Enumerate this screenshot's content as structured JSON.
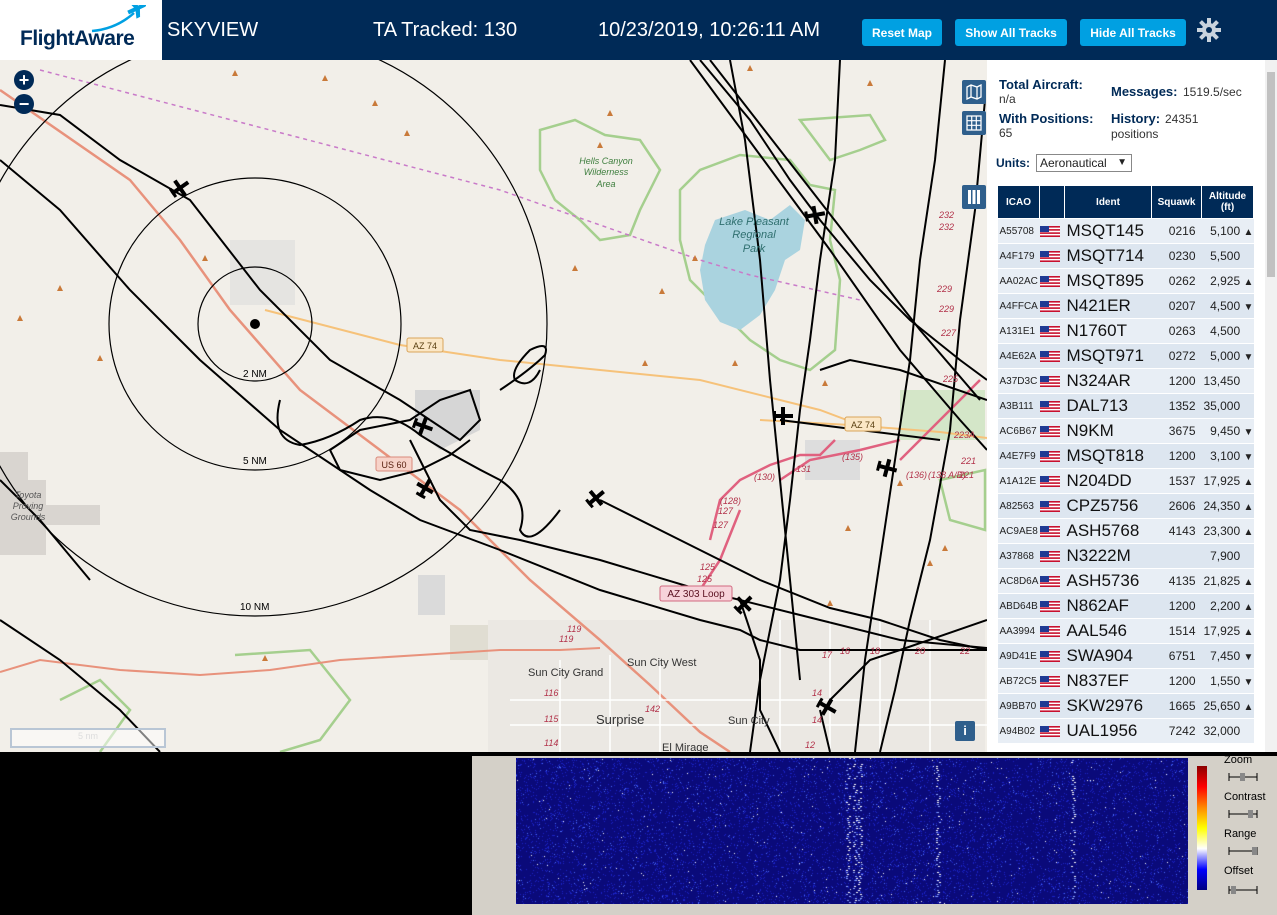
{
  "header": {
    "logo_text": "FlightAware",
    "app_name": "SKYVIEW",
    "tracked": "TA Tracked: 130",
    "datetime": "10/23/2019, 10:26:11 AM",
    "buttons": [
      "Reset Map",
      "Show All Tracks",
      "Hide All Tracks"
    ]
  },
  "map": {
    "zoom_in": "+",
    "zoom_out": "−",
    "scale_label": "5 nm",
    "info": "i",
    "range_labels": [
      "2 NM",
      "5 NM",
      "10 NM"
    ],
    "labels": {
      "hells_canyon": [
        "Hells Canyon",
        "Wilderness",
        "Area"
      ],
      "lake": [
        "Lake Pleasant",
        "Regional",
        "Park"
      ],
      "toyota": [
        "Toyota",
        "Proving",
        "Grounds"
      ],
      "az74_a": "AZ 74",
      "az74_b": "AZ 74",
      "us60": "US 60",
      "az303": "AZ 303 Loop",
      "sun_city_grand": "Sun City Grand",
      "sun_city_west": "Sun City West",
      "surprise": "Surprise",
      "sun_city": "Sun City",
      "el_mirage": "El Mirage",
      "numbers": [
        "232",
        "232",
        "229",
        "229",
        "227",
        "225",
        "223A",
        "221",
        "221",
        "(136)",
        "(138 A/B)",
        "(135)",
        "131",
        "(130)",
        "(128)",
        "127",
        "127",
        "125",
        "125",
        "119",
        "119",
        "116",
        "115",
        "114",
        "142",
        "17",
        "16",
        "18",
        "20",
        "22",
        "14",
        "14",
        "12"
      ]
    }
  },
  "sidebar": {
    "total_aircraft_label": "Total Aircraft:",
    "total_aircraft_value": "n/a",
    "messages_label": "Messages:",
    "messages_value": "1519.5/sec",
    "with_positions_label": "With Positions:",
    "with_positions_value": "65",
    "history_label": "History:",
    "history_value": "24351",
    "history_unit": "positions",
    "units_label": "Units:",
    "units_value": "Aeronautical",
    "columns": [
      "ICAO",
      "Ident",
      "Squawk",
      "Altitude (ft)"
    ],
    "rows": [
      {
        "icao": "A55708",
        "ident": "MSQT145",
        "squawk": "0216",
        "alt": "5,100",
        "trend": "▲"
      },
      {
        "icao": "A4F179",
        "ident": "MSQT714",
        "squawk": "0230",
        "alt": "5,500",
        "trend": ""
      },
      {
        "icao": "AA02AC",
        "ident": "MSQT895",
        "squawk": "0262",
        "alt": "2,925",
        "trend": "▲"
      },
      {
        "icao": "A4FFCA",
        "ident": "N421ER",
        "squawk": "0207",
        "alt": "4,500",
        "trend": "▼"
      },
      {
        "icao": "A131E1",
        "ident": "N1760T",
        "squawk": "0263",
        "alt": "4,500",
        "trend": ""
      },
      {
        "icao": "A4E62A",
        "ident": "MSQT971",
        "squawk": "0272",
        "alt": "5,000",
        "trend": "▼"
      },
      {
        "icao": "A37D3C",
        "ident": "N324AR",
        "squawk": "1200",
        "alt": "13,450",
        "trend": ""
      },
      {
        "icao": "A3B111",
        "ident": "DAL713",
        "squawk": "1352",
        "alt": "35,000",
        "trend": ""
      },
      {
        "icao": "AC6B67",
        "ident": "N9KM",
        "squawk": "3675",
        "alt": "9,450",
        "trend": "▼"
      },
      {
        "icao": "A4E7F9",
        "ident": "MSQT818",
        "squawk": "1200",
        "alt": "3,100",
        "trend": "▼"
      },
      {
        "icao": "A1A12E",
        "ident": "N204DD",
        "squawk": "1537",
        "alt": "17,925",
        "trend": "▲"
      },
      {
        "icao": "A82563",
        "ident": "CPZ5756",
        "squawk": "2606",
        "alt": "24,350",
        "trend": "▲"
      },
      {
        "icao": "AC9AE8",
        "ident": "ASH5768",
        "squawk": "4143",
        "alt": "23,300",
        "trend": "▲"
      },
      {
        "icao": "A37868",
        "ident": "N3222M",
        "squawk": "",
        "alt": "7,900",
        "trend": ""
      },
      {
        "icao": "AC8D6A",
        "ident": "ASH5736",
        "squawk": "4135",
        "alt": "21,825",
        "trend": "▲"
      },
      {
        "icao": "ABD64B",
        "ident": "N862AF",
        "squawk": "1200",
        "alt": "2,200",
        "trend": "▲"
      },
      {
        "icao": "AA3994",
        "ident": "AAL546",
        "squawk": "1514",
        "alt": "17,925",
        "trend": "▲"
      },
      {
        "icao": "A9D41E",
        "ident": "SWA904",
        "squawk": "6751",
        "alt": "7,450",
        "trend": "▼"
      },
      {
        "icao": "AB72C5",
        "ident": "N837EF",
        "squawk": "1200",
        "alt": "1,550",
        "trend": "▼"
      },
      {
        "icao": "A9BB70",
        "ident": "SKW2976",
        "squawk": "1665",
        "alt": "25,650",
        "trend": "▲"
      },
      {
        "icao": "A94B02",
        "ident": "UAL1956",
        "squawk": "7242",
        "alt": "32,000",
        "trend": ""
      }
    ]
  },
  "waterfall": {
    "controls": [
      "Zoom",
      "Contrast",
      "Range",
      "Offset"
    ]
  },
  "colors": {
    "brand_navy": "#002a57",
    "button_blue": "#00a0e2"
  }
}
